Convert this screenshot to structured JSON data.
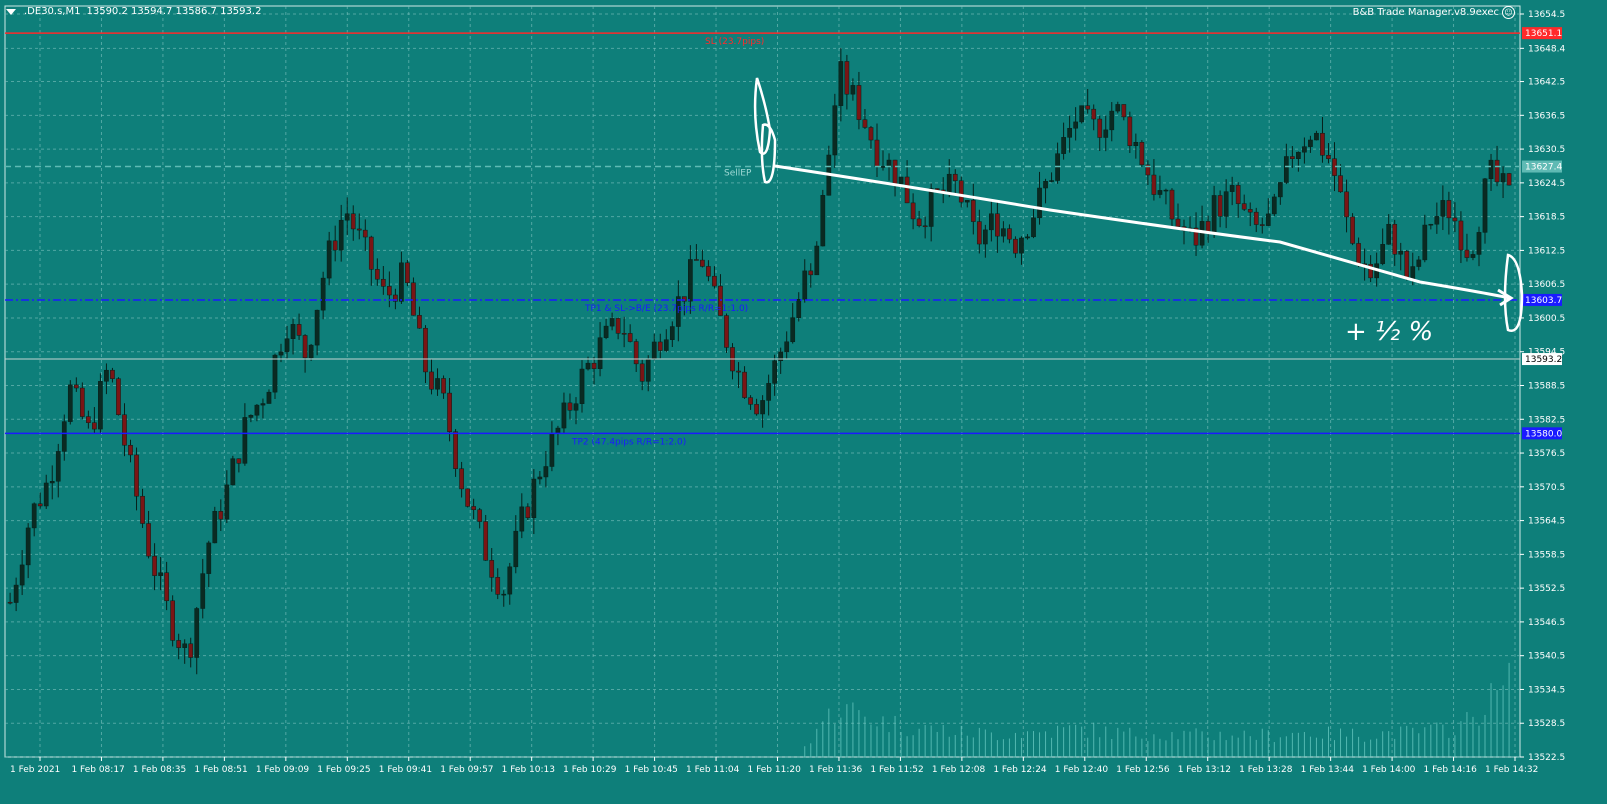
{
  "header": {
    "symbol": ".DE30.s,M1",
    "ohlc": "13590.2 13594.7 13586.7 13593.2",
    "ea_name": "B&B Trade Manager.v8.9exec"
  },
  "colors": {
    "background": "#0e7f7a",
    "grid": "#7fc3bf",
    "bull": "#0a2a22",
    "bear": "#7a1515",
    "sl_line": "#ff2a2a",
    "tp_line": "#1a1aff",
    "annotation": "#ffffff"
  },
  "levels": {
    "sl": {
      "value": 13651.1,
      "price_label": "13651.1",
      "text": "SL (23.7pips)"
    },
    "sell_entry": {
      "value": 13627.4,
      "price_label": "13627.4",
      "text": "SellEP"
    },
    "tp1": {
      "value": 13603.7,
      "price_label": "13603.7",
      "text": "TP1 & SL->B/E (23.7pips R/R=1:1.0)"
    },
    "current": {
      "value": 13593.2,
      "price_label": "13593.2"
    },
    "tp2": {
      "value": 13580.0,
      "price_label": "13580.0",
      "text": "TP2 (47.4pips R/R=1:2.0)"
    }
  },
  "handwriting": {
    "note": "+ ½ %"
  },
  "chart_data": {
    "type": "candlestick",
    "title": ".DE30.s,M1",
    "xlabel": "",
    "ylabel": "",
    "ylim": [
      13522.5,
      13654.5
    ],
    "y_ticks": [
      "13654.5",
      "13648.4",
      "13642.5",
      "13636.5",
      "13630.5",
      "13624.5",
      "13618.5",
      "13612.5",
      "13606.5",
      "13600.5",
      "13594.5",
      "13588.5",
      "13582.5",
      "13576.5",
      "13570.5",
      "13564.5",
      "13558.5",
      "13552.5",
      "13546.5",
      "13540.5",
      "13534.5",
      "13528.5",
      "13522.5"
    ],
    "x_ticks": [
      "1 Feb 2021",
      "1 Feb 08:17",
      "1 Feb 08:35",
      "1 Feb 08:51",
      "1 Feb 09:09",
      "1 Feb 09:25",
      "1 Feb 09:41",
      "1 Feb 09:57",
      "1 Feb 10:13",
      "1 Feb 10:29",
      "1 Feb 10:45",
      "1 Feb 11:04",
      "1 Feb 11:20",
      "1 Feb 11:36",
      "1 Feb 11:52",
      "1 Feb 12:08",
      "1 Feb 12:24",
      "1 Feb 12:40",
      "1 Feb 12:56",
      "1 Feb 13:12",
      "1 Feb 13:28",
      "1 Feb 13:44",
      "1 Feb 14:00",
      "1 Feb 14:16",
      "1 Feb 14:32"
    ],
    "close_path": [
      13550,
      13565,
      13572,
      13588,
      13580,
      13592,
      13575,
      13560,
      13548,
      13540,
      13560,
      13570,
      13582,
      13588,
      13600,
      13594,
      13610,
      13620,
      13612,
      13604,
      13608,
      13592,
      13585,
      13570,
      13560,
      13552,
      13565,
      13575,
      13582,
      13590,
      13596,
      13600,
      13590,
      13598,
      13604,
      13612,
      13600,
      13590,
      13585,
      13594,
      13604,
      13615,
      13644,
      13638,
      13630,
      13626,
      13618,
      13622,
      13624,
      13614,
      13618,
      13614,
      13620,
      13628,
      13636,
      13634,
      13638,
      13632,
      13624,
      13618,
      13614,
      13620,
      13622,
      13616,
      13618,
      13630,
      13634,
      13628,
      13614,
      13608,
      13616,
      13606,
      13618,
      13620,
      13612,
      13626,
      13622
    ],
    "volume_path": [
      0,
      0,
      0,
      0,
      0,
      0,
      0,
      0,
      0,
      0,
      0,
      0,
      0,
      0,
      0,
      0,
      0,
      0,
      0,
      0,
      0,
      0,
      0,
      0,
      0,
      0,
      0,
      0,
      0,
      0,
      0,
      0,
      0,
      0,
      0,
      0,
      0,
      0,
      0,
      0,
      0,
      0.4,
      0.6,
      0.55,
      0.45,
      0.4,
      0.35,
      0.35,
      0.3,
      0.3,
      0.28,
      0.3,
      0.3,
      0.32,
      0.35,
      0.33,
      0.3,
      0.28,
      0.3,
      0.28,
      0.27,
      0.27,
      0.28,
      0.27,
      0.27,
      0.3,
      0.3,
      0.28,
      0.28,
      0.28,
      0.3,
      0.3,
      0.32,
      0.35,
      0.45,
      0.7,
      0.9
    ]
  }
}
